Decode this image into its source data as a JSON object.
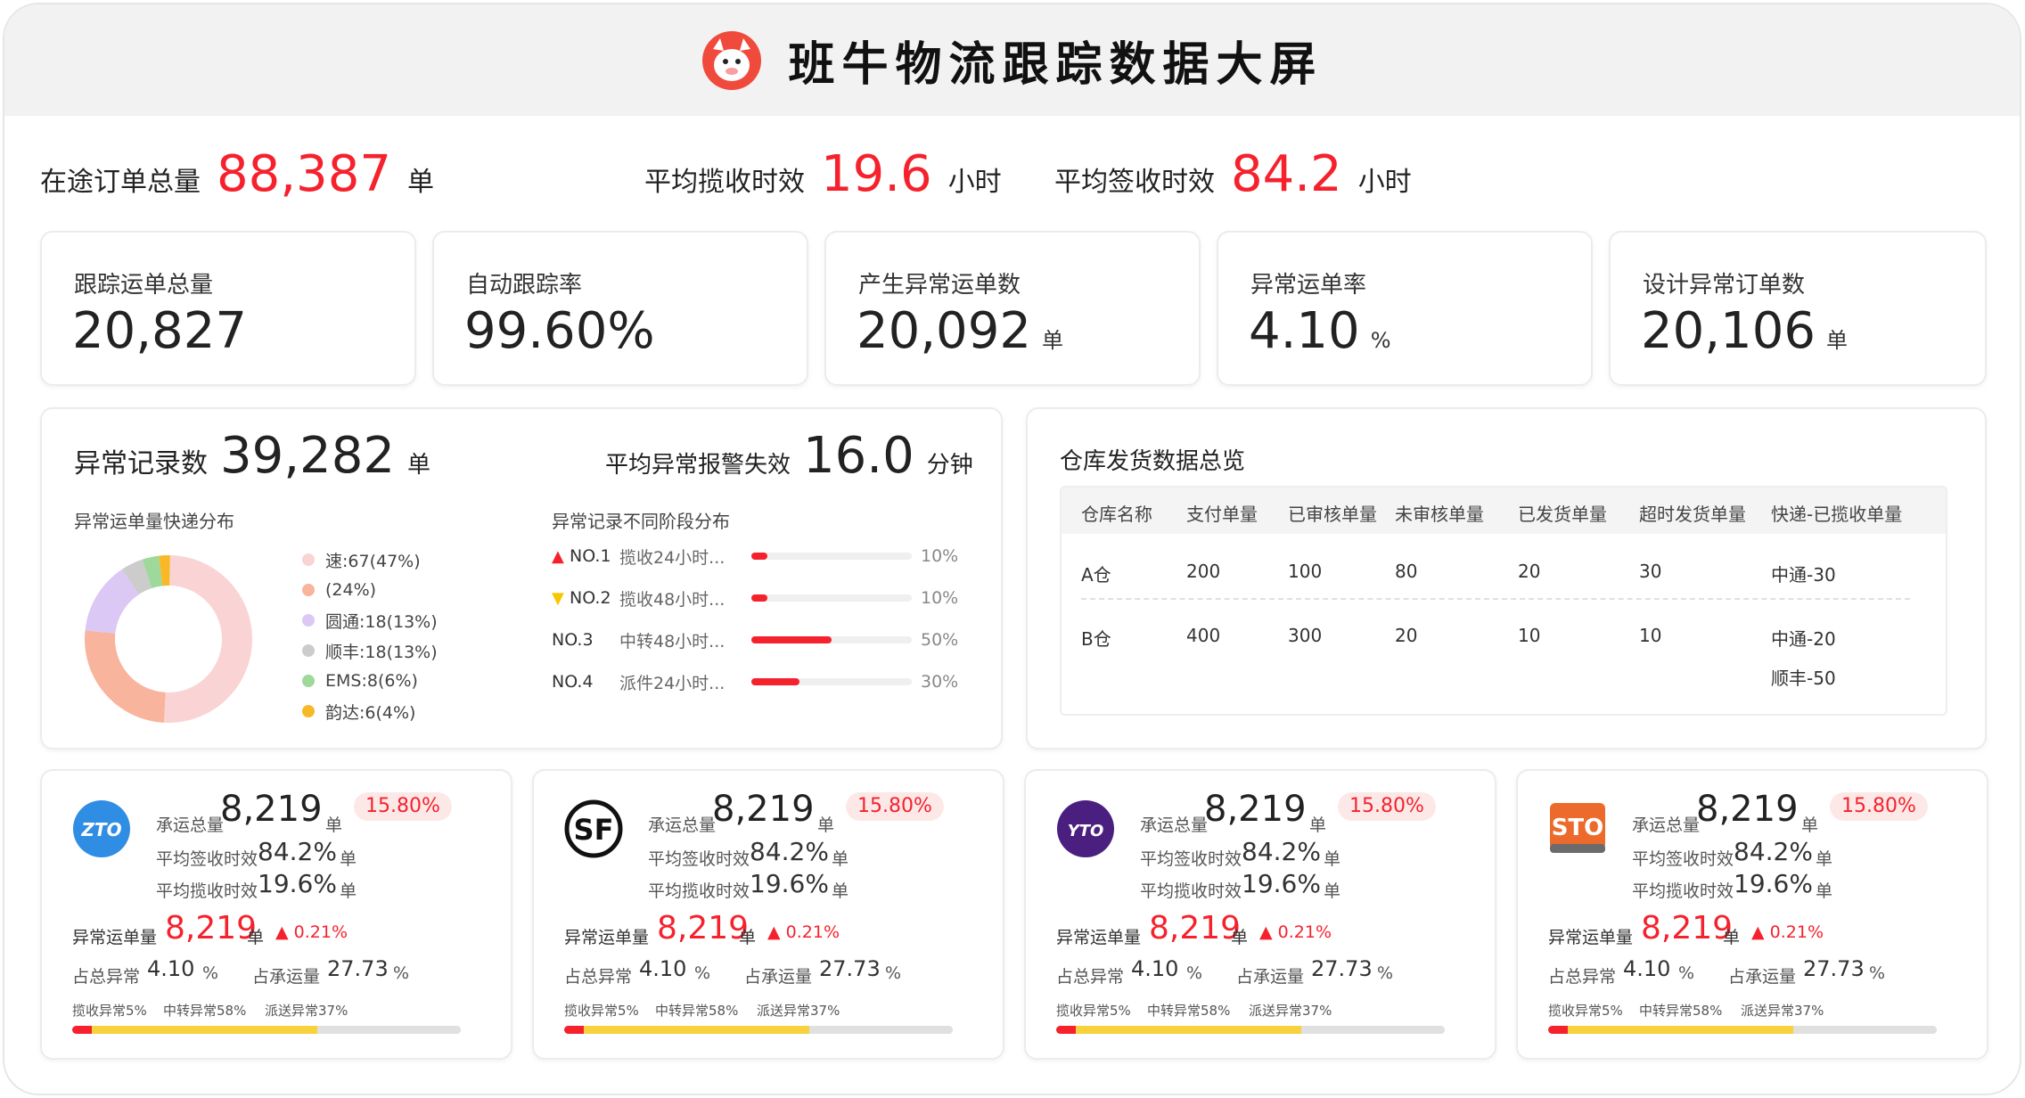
{
  "header": {
    "title": "班牛物流跟踪数据大屏",
    "logo_icon": "cow-mascot-icon"
  },
  "summary": [
    {
      "label": "在途订单总量",
      "value": "88,387",
      "unit": "单"
    },
    {
      "label": "平均揽收时效",
      "value": "19.6",
      "unit": "小时"
    },
    {
      "label": "平均签收时效",
      "value": "84.2",
      "unit": "小时"
    }
  ],
  "kpis": [
    {
      "label": "跟踪运单总量",
      "value": "20,827",
      "unit": ""
    },
    {
      "label": "自动跟踪率",
      "value": "99.60%",
      "unit": ""
    },
    {
      "label": "产生异常运单数",
      "value": "20,092",
      "unit": "单"
    },
    {
      "label": "异常运单率",
      "value": "4.10",
      "unit": "%"
    },
    {
      "label": "设计异常订单数",
      "value": "20,106",
      "unit": "单"
    }
  ],
  "exceptions": {
    "title": "异常记录数",
    "count": "39,282",
    "count_unit": "单",
    "alert_label": "平均异常报警失效",
    "alert_value": "16.0",
    "alert_unit": "分钟",
    "distribution_title": "异常运单量快递分布",
    "distribution": [
      {
        "label": "速:67(47%)",
        "value": 47,
        "color": "#fad4d4"
      },
      {
        "label": "(24%)",
        "value": 24,
        "color": "#f8b49c"
      },
      {
        "label": "圆通:18(13%)",
        "value": 13,
        "color": "#dcc8f5"
      },
      {
        "label": "顺丰:18(13%)",
        "value": 4,
        "color": "#cccccc"
      },
      {
        "label": "EMS:8(6%)",
        "value": 3,
        "color": "#9ed89a"
      },
      {
        "label": "韵达:6(4%)",
        "value": 2,
        "color": "#f7b928"
      }
    ],
    "stage_title": "异常记录不同阶段分布",
    "stages": [
      {
        "mark": "▲",
        "mark_color": "#f5222d",
        "no": "NO.1",
        "text": "揽收24小时...",
        "percent": 10,
        "pct_label": "10%"
      },
      {
        "mark": "▼",
        "mark_color": "#f7c600",
        "no": "NO.2",
        "text": "揽收48小时...",
        "percent": 10,
        "pct_label": "10%"
      },
      {
        "mark": "",
        "mark_color": "#333333",
        "no": "NO.3",
        "text": "中转48小时...",
        "percent": 50,
        "pct_label": "50%"
      },
      {
        "mark": "",
        "mark_color": "#333333",
        "no": "NO.4",
        "text": "派件24小时...",
        "percent": 30,
        "pct_label": "30%"
      }
    ]
  },
  "warehouse": {
    "title": "仓库发货数据总览",
    "headers": [
      "仓库名称",
      "支付单量",
      "已审核单量",
      "未审核单量",
      "已发货单量",
      "超时发货单量",
      "快递-已揽收单量"
    ],
    "rows": [
      {
        "name": "A仓",
        "paid": "200",
        "reviewed": "100",
        "unreviewed": "80",
        "shipped": "20",
        "overdue": "30",
        "express": [
          "中通-30"
        ]
      },
      {
        "name": "B仓",
        "paid": "400",
        "reviewed": "300",
        "unreviewed": "20",
        "shipped": "10",
        "overdue": "10",
        "express": [
          "中通-20",
          "顺丰-50"
        ]
      }
    ]
  },
  "carriers": [
    {
      "logo": "zto-logo-icon",
      "logo_text": "ZTO",
      "logo_color": "#2f8de4"
    },
    {
      "logo": "sf-logo-icon",
      "logo_text": "SF",
      "logo_color": "#111111"
    },
    {
      "logo": "yto-logo-icon",
      "logo_text": "YTO",
      "logo_color": "#4b1f80"
    },
    {
      "logo": "sto-logo-icon",
      "logo_text": "STO",
      "logo_color": "#ec6a2c"
    }
  ],
  "carrier_stats": {
    "volume_label": "承运总量",
    "volume": "8,219",
    "volume_unit": "单",
    "badge": "15.80%",
    "sign_label": "平均签收时效",
    "sign_value": "84.2%",
    "sign_unit": "单",
    "pickup_label": "平均揽收时效",
    "pickup_value": "19.6%",
    "pickup_unit": "单",
    "abn_label": "异常运单量",
    "abn_value": "8,219",
    "abn_unit": "单",
    "abn_trend": "▲ 0.21%",
    "share_total_label": "占总异常",
    "share_total_value": "4.10",
    "share_total_unit": "%",
    "share_vol_label": "占承运量",
    "share_vol_value": "27.73",
    "share_vol_unit": "%",
    "seg_pickup_label": "揽收异常5%",
    "seg_transit_label": "中转异常58%",
    "seg_delivery_label": "派送异常37%",
    "segments": [
      {
        "name": "揽收异常",
        "percent": 5,
        "color": "#f5222d"
      },
      {
        "name": "中转异常",
        "percent": 58,
        "color": "#f8d23c"
      },
      {
        "name": "派送异常",
        "percent": 37,
        "color": "#e0e0e0"
      }
    ]
  }
}
